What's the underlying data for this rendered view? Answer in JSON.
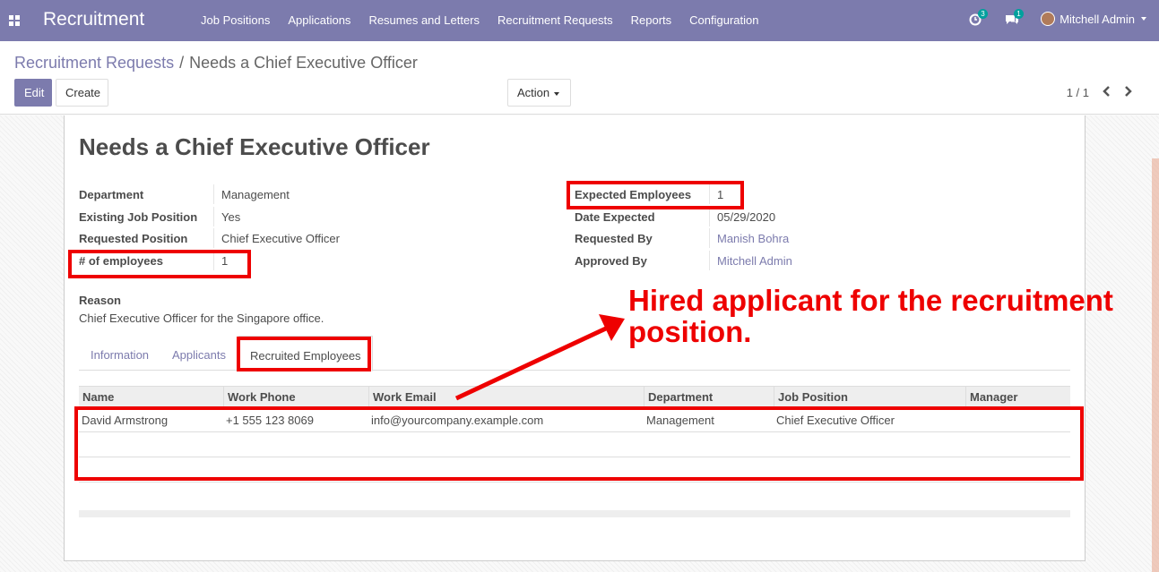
{
  "navbar": {
    "app_title": "Recruitment",
    "menu": [
      "Job Positions",
      "Applications",
      "Resumes and Letters",
      "Recruitment Requests",
      "Reports",
      "Configuration"
    ],
    "activity_count": "3",
    "message_count": "1",
    "user": "Mitchell Admin"
  },
  "breadcrumb": {
    "parent": "Recruitment Requests",
    "separator": "/",
    "current": "Needs a Chief Executive Officer"
  },
  "buttons": {
    "edit": "Edit",
    "create": "Create",
    "action": "Action"
  },
  "pager": "1 / 1",
  "record": {
    "title": "Needs a Chief Executive Officer",
    "left_fields": [
      {
        "label": "Department",
        "value": "Management"
      },
      {
        "label": "Existing Job Position",
        "value": "Yes"
      },
      {
        "label": "Requested Position",
        "value": "Chief Executive Officer"
      },
      {
        "label": "# of employees",
        "value": "1"
      }
    ],
    "right_fields": [
      {
        "label": "Expected Employees",
        "value": "1"
      },
      {
        "label": "Date Expected",
        "value": "05/29/2020"
      },
      {
        "label": "Requested By",
        "value": "Manish Bohra"
      },
      {
        "label": "Approved By",
        "value": "Mitchell Admin"
      }
    ],
    "reason_label": "Reason",
    "reason_value": "Chief Executive Officer for the Singapore office."
  },
  "tabs": [
    "Information",
    "Applicants",
    "Recruited Employees"
  ],
  "table": {
    "columns": [
      "Name",
      "Work Phone",
      "Work Email",
      "Department",
      "Job Position",
      "Manager"
    ],
    "rows": [
      [
        "David Armstrong",
        "+1 555 123 8069",
        "info@yourcompany.example.com",
        "Management",
        "Chief Executive Officer",
        ""
      ]
    ]
  },
  "annotation": {
    "line1": "Hired applicant for the recruitment",
    "line2": "position.",
    "color": "#ee0000"
  },
  "colors": {
    "brand": "#7c7bad",
    "badge": "#00a09d"
  }
}
